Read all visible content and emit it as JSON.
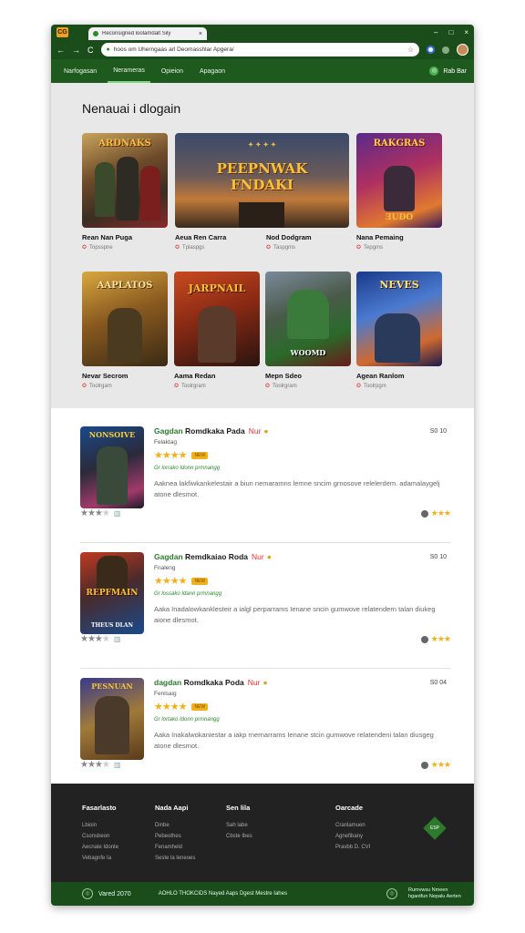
{
  "browser": {
    "tab_title": "Reconsigned loolamdalt Sily",
    "tab_close": "×",
    "window_controls": [
      "–",
      "□",
      "×"
    ],
    "nav": [
      "←",
      "→",
      "C"
    ],
    "url": "hoos om Uherngaas arl Deomasshlar Apgera/",
    "bookmark_icon": "☆"
  },
  "menu": {
    "items": [
      "Narfogasan",
      "Nerameras",
      "Opieion",
      "Apagaon"
    ],
    "active_index": 1,
    "right_label": "Rab Bar"
  },
  "hero": {
    "heading": "Nenauai i dlogain",
    "row1": [
      {
        "name": "Rean Nan Puga",
        "sub": "Topsspne",
        "art": "ARDNAKS"
      },
      {
        "name": "Aeua Ren Carra",
        "sub": "Tplaspgs",
        "art": "PEEPNWAK FNDAKI"
      },
      {
        "name": "Nod Dodgram",
        "sub": "Taspgms",
        "art": ""
      },
      {
        "name": "Nana Pemaing",
        "sub": "Tepgms",
        "art": "RAKGRAS"
      }
    ],
    "row2": [
      {
        "name": "Nevar Secrom",
        "sub": "Toolrgam",
        "art": "AAPLATOS"
      },
      {
        "name": "Aama Redan",
        "sub": "Toolrgram",
        "art": "JARPNAIL"
      },
      {
        "name": "Mepn Sdeo",
        "sub": "Toolrgram",
        "art": "WOOMD"
      },
      {
        "name": "Agean Ranlom",
        "sub": "Toolrpgm",
        "art": "NEVES"
      }
    ]
  },
  "list": [
    {
      "title_green": "Gagdan",
      "title_rest": "Romdkaka Pada",
      "new": "Nur",
      "sub": "Felaktag",
      "badge": "NEW",
      "meta": "Gr lorrako Idonn prmnangg",
      "desc": "Aaknea lakfiwkankelestair a biun nemaramns lemne sncim grnosove relelerdem. adamalaygelj atone dlesmot.",
      "price": "S0 10",
      "cover": "NONSOIVE"
    },
    {
      "title_green": "Gagdan",
      "title_rest": "Remdkaiao Roda",
      "new": "Nur",
      "sub": "Fnaleng",
      "badge": "NEW",
      "meta": "Gr lossako Idann prmnangg",
      "desc": "Aaka Inadalowkanklesteir a ialgl perparrams Ienane sncin gumwove relatendern talan diukeg aione dlesmot.",
      "price": "S0 10",
      "cover": "REPFMAIN"
    },
    {
      "title_green": "dagdan",
      "title_rest": "Romdkaka Poda",
      "new": "Nur",
      "sub": "Fenlsaig",
      "badge": "NEW",
      "meta": "Gr lortako Idonn prmnangg",
      "desc": "Aaka Inakalwokaniestar a iakp rnernarrams Ienane stcin gumwove relatendeni talan diusgeg atone dlesmot.",
      "price": "S0 04",
      "cover": "PESNUAN"
    }
  ],
  "footer": {
    "columns": [
      {
        "heading": "Fasarlasto",
        "links": [
          "Lbioin",
          "Csonsbeon",
          "Aecnale Idonte",
          "Vebagnfe Ia"
        ]
      },
      {
        "heading": "Nada Aapi",
        "links": [
          "Dinbe",
          "Pebeothes",
          "Fenamheld",
          "Seste la leneoes"
        ]
      },
      {
        "heading": "Sen lila",
        "links": [
          "Sah labe",
          "Cbste Ibes"
        ]
      },
      {
        "heading": "Oarcade",
        "links": [
          "Cranlamuen",
          "Agnefibany",
          "Pravbb D. CVI"
        ]
      }
    ],
    "badge": "ESP"
  },
  "bottombar": {
    "copyright": "Vared 2070",
    "links": "AOHLO THOKCIDS  Nayed Aaps  Dgest  Mestre Iahes",
    "right_text": "Rumvwsu Nmeen hgaotfun Nepalu Aerten"
  }
}
